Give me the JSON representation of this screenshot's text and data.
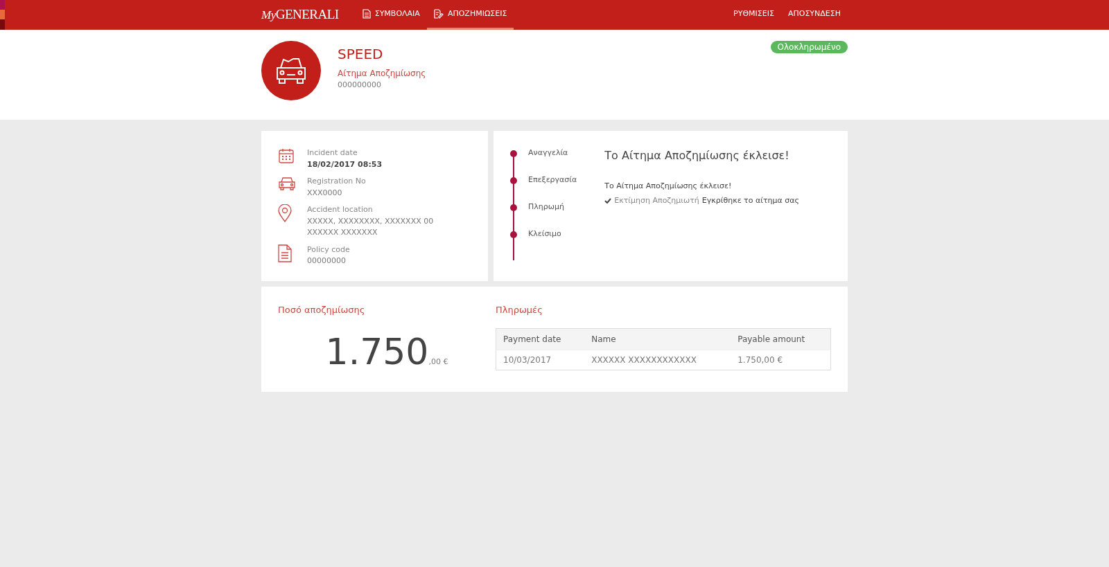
{
  "navbar": {
    "logo_prefix": "My",
    "logo": "GENERALI",
    "links": [
      {
        "label": "ΣΥΜΒΟΛΑΙΑ",
        "selected": false
      },
      {
        "label": "ΑΠΟΖΗΜΙΩΣΕΙΣ",
        "selected": true
      }
    ],
    "right_links": [
      "ΡΥΘΜΙΣΕΙΣ",
      "ΑΠΟΣΥΝΔΕΣΗ"
    ]
  },
  "header": {
    "title": "SPEED",
    "subtitle": "Αίτημα Αποζημίωσης",
    "number": "000000000",
    "status": "Ολοκληρωμένο"
  },
  "details": [
    {
      "kind": "calendar",
      "label": "Incident date",
      "value": "18/02/2017 08:53",
      "bold": true
    },
    {
      "kind": "car",
      "label": "Registration No",
      "value": "XXX0000",
      "bold": false
    },
    {
      "kind": "pin",
      "label": "Accident location",
      "value": "XXXXX, XXXXXXXX, XXXXXXX 00 XXXXXX XXXXXXX",
      "bold": false
    },
    {
      "kind": "document",
      "label": "Policy code",
      "value": "00000000",
      "bold": false
    }
  ],
  "timeline": {
    "steps": [
      "Αναγγελία",
      "Επεξεργασία",
      "Πληρωμή",
      "Κλείσιμο"
    ],
    "heading": "Το Αίτημα Αποζημίωσης έκλεισε!",
    "message": "Το Αίτημα Αποζημίωσης έκλεισε!",
    "entries": [
      {
        "source": "Εκτίμηση Αποζημιωτή",
        "text": "Εγκρίθηκε το αίτημα σας"
      }
    ]
  },
  "amount": {
    "title": "Ποσό αποζημίωσης",
    "integer": "1.750",
    "decimals": ",00 €"
  },
  "payments": {
    "title": "Πληρωμές",
    "columns": [
      "Payment date",
      "Name",
      "Payable amount"
    ],
    "rows": [
      [
        "10/03/2017",
        "XXXXXX XXXXXXXXXXXX",
        "1.750,00 €"
      ]
    ]
  }
}
